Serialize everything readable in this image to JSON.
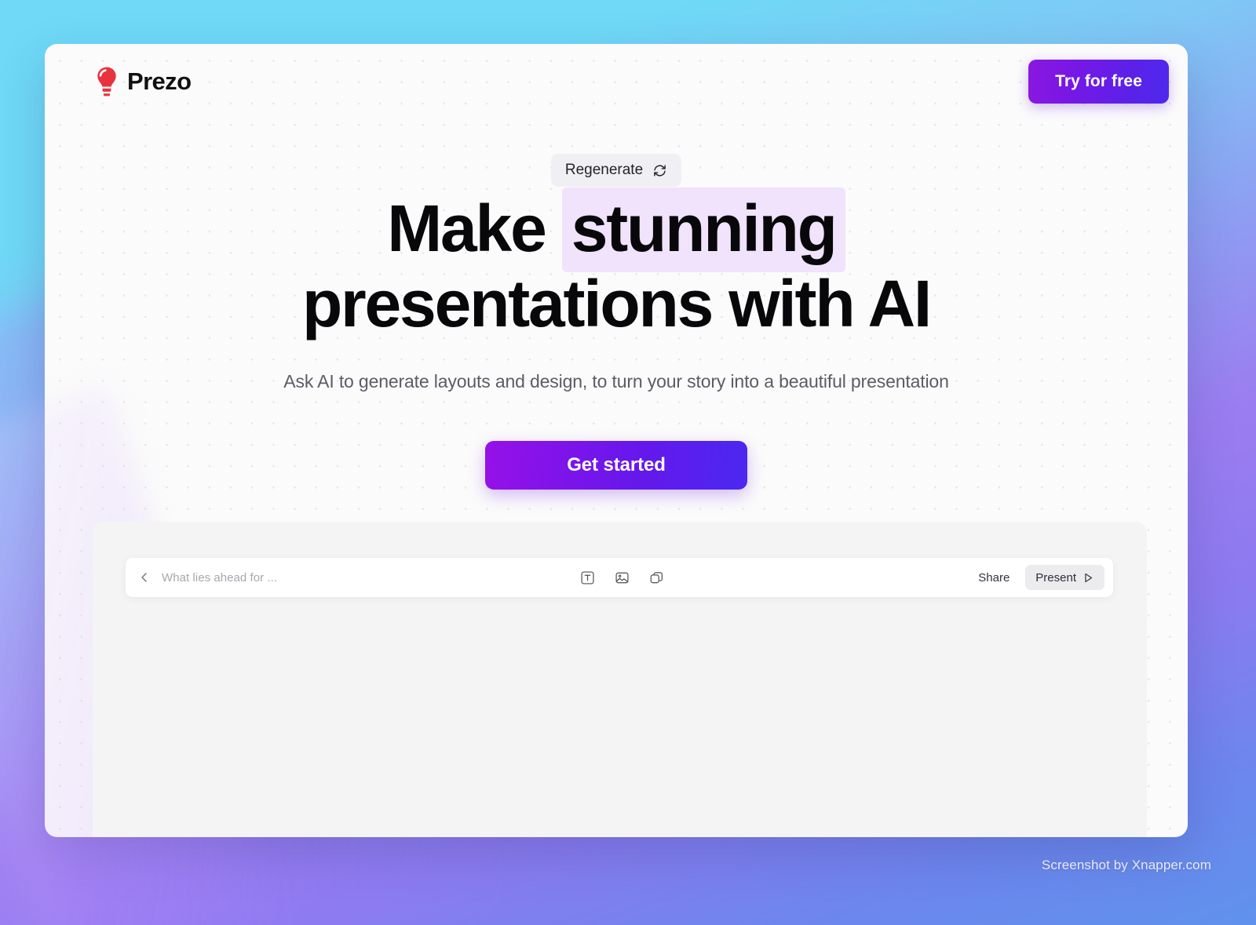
{
  "app": {
    "brand_name": "Prezo",
    "brand_icon": "lightbulb-icon",
    "brand_color": "#e8333f"
  },
  "header": {
    "cta_label": "Try for free"
  },
  "hero": {
    "regenerate_label": "Regenerate",
    "regenerate_icon": "refresh-cycle-icon",
    "headline_part1": "Make ",
    "headline_accent": "stunning",
    "headline_line2": "presentations with AI",
    "headline_accent_bg": "#f0e3fb",
    "subheadline": "Ask AI to generate layouts and design, to turn your story into a beautiful presentation",
    "primary_cta_label": "Get started",
    "primary_cta_gradient_from": "#9611e8",
    "primary_cta_gradient_to": "#4b28f0"
  },
  "editor": {
    "back_icon": "chevron-left-icon",
    "document_title": "What lies ahead for ...",
    "tools": [
      {
        "name": "text-tool-icon",
        "label": "Text"
      },
      {
        "name": "image-tool-icon",
        "label": "Image"
      },
      {
        "name": "shapes-tool-icon",
        "label": "Shapes"
      }
    ],
    "share_label": "Share",
    "present_label": "Present",
    "present_icon": "play-icon"
  },
  "watermark": {
    "text": "Screenshot by Xnapper.com"
  }
}
